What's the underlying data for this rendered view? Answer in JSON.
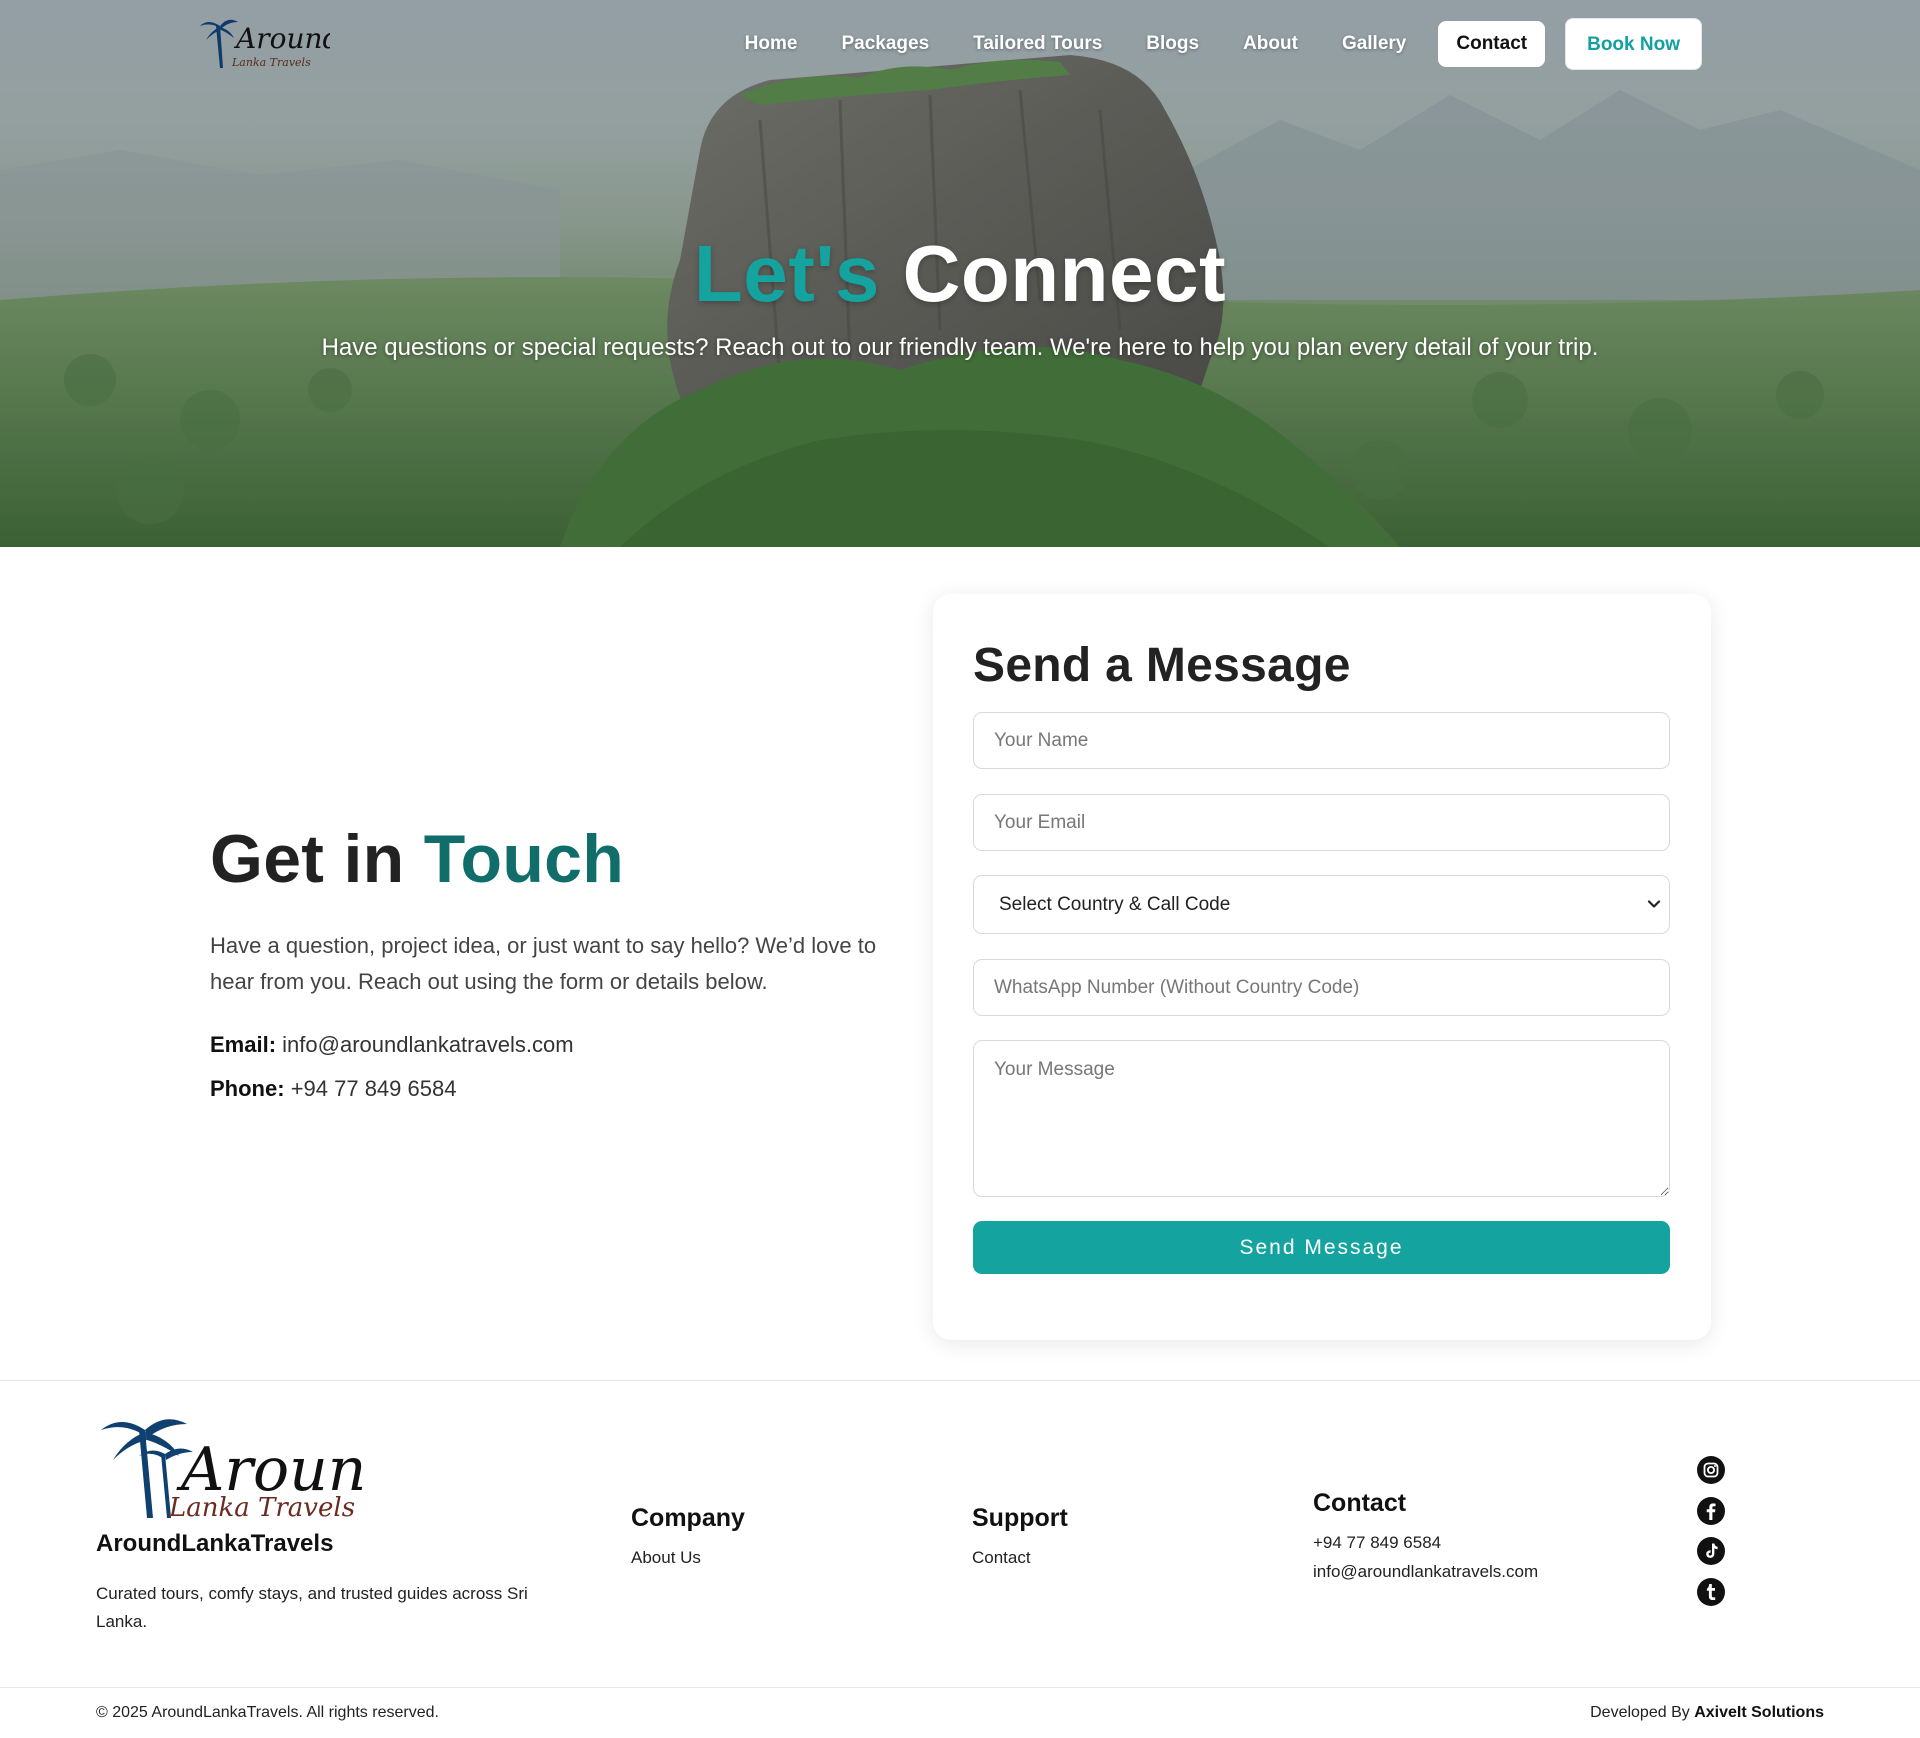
{
  "nav": {
    "items": [
      "Home",
      "Packages",
      "Tailored Tours",
      "Blogs",
      "About",
      "Gallery"
    ],
    "contact": "Contact",
    "book": "Book Now"
  },
  "logo": {
    "word": "Around",
    "sub": "Lanka Travels"
  },
  "hero": {
    "title_accent": "Let's",
    "title_rest": "Connect",
    "subtitle": "Have questions or special requests? Reach out to our friendly team. We're here to help you plan every detail of your trip."
  },
  "get_in_touch": {
    "title_main": "Get in",
    "title_accent": "Touch",
    "description": "Have a question, project idea, or just want to say hello? We’d love to hear from you. Reach out using the form or details below.",
    "email_label": "Email:",
    "email_value": "info@aroundlankatravels.com",
    "phone_label": "Phone:",
    "phone_value": "+94 77 849 6584"
  },
  "form": {
    "title": "Send a Message",
    "name_placeholder": "Your Name",
    "email_placeholder": "Your Email",
    "country_selected": "Select Country & Call Code",
    "whatsapp_placeholder": "WhatsApp Number (Without Country Code)",
    "message_placeholder": "Your Message",
    "submit": "Send Message"
  },
  "footer": {
    "brand": "AroundLankaTravels",
    "tagline": "Curated tours, comfy stays, and trusted guides across Sri Lanka.",
    "company_title": "Company",
    "company_link": "About Us",
    "support_title": "Support",
    "support_link": "Contact",
    "contact_title": "Contact",
    "contact_phone": "+94 77 849 6584",
    "contact_email": "info@aroundlankatravels.com",
    "socials": [
      "instagram-icon",
      "facebook-icon",
      "tiktok-icon",
      "tumblr-icon"
    ],
    "copyright": "© 2025 AroundLankaTravels. All rights reserved.",
    "developed_prefix": "Developed By",
    "developer": "AxiveIt Solutions"
  },
  "colors": {
    "accent": "#15a3a0",
    "accent_dark": "#116d6a",
    "text": "#222222"
  }
}
